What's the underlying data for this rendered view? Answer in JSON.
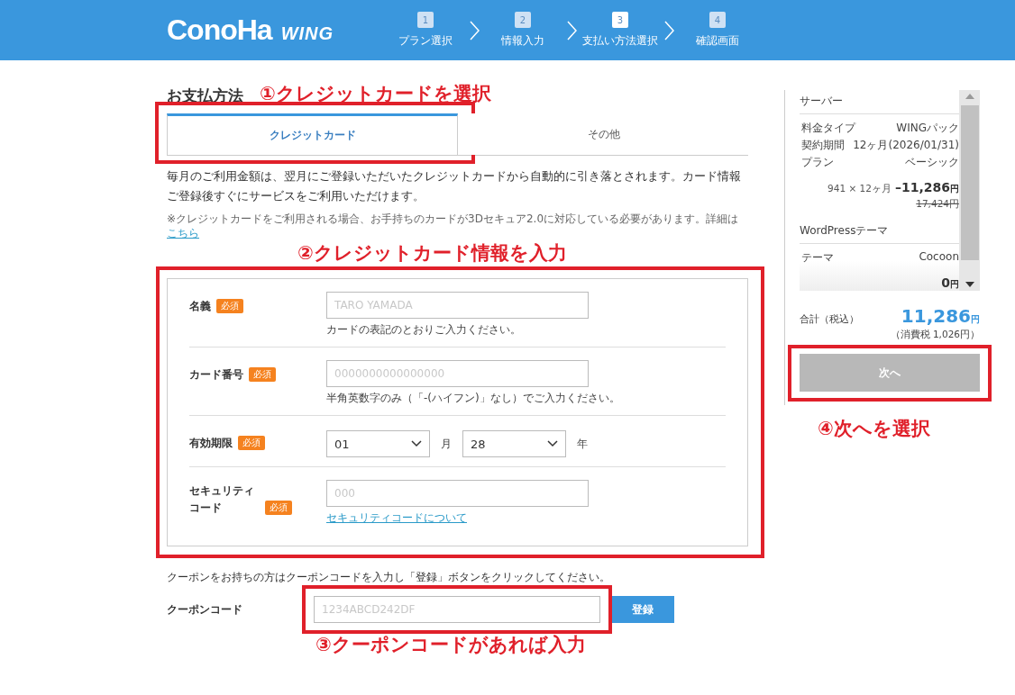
{
  "header": {
    "logo": "ConoHa",
    "product": "WING",
    "steps": [
      {
        "number": "1",
        "label": "プラン選択",
        "selected": false
      },
      {
        "number": "2",
        "label": "情報入力",
        "selected": false
      },
      {
        "number": "3",
        "label": "支払い方法選択",
        "selected": true
      },
      {
        "number": "4",
        "label": "確認画面",
        "selected": false
      }
    ]
  },
  "payment": {
    "title": "お支払方法",
    "tabs": [
      {
        "label": "クレジットカード",
        "selected": true
      },
      {
        "label": "その他",
        "selected": false
      }
    ],
    "description": "毎月のご利用金額は、翌月にご登録いただいたクレジットカードから自動的に引き落とされます。カード情報ご登録後すぐにサービスをご利用いただけます。",
    "note": "※クレジットカードをご利用される場合、お手持ちのカードが3Dセキュア2.0に対応している必要があります。詳細は",
    "note_link": "こちら",
    "fields": [
      {
        "kind": "text",
        "label": "名義",
        "badge": "必須",
        "placeholder": "TARO YAMADA",
        "hint": "カードの表記のとおりご入力ください。"
      },
      {
        "kind": "text",
        "label": "カード番号",
        "badge": "必須",
        "placeholder": "0000000000000000",
        "hint": "半角英数字のみ（「-(ハイフン)」なし）でご入力ください。"
      },
      {
        "kind": "expiry",
        "label": "有効期限",
        "badge": "必須",
        "selects": [
          {
            "value": "01",
            "unit": "月"
          },
          {
            "value": "28",
            "unit": "年"
          }
        ]
      },
      {
        "kind": "cvc",
        "label": "セキュリティコード",
        "badge": "必須",
        "placeholder": "000",
        "help_link": "セキュリティコードについて"
      }
    ]
  },
  "coupon": {
    "text": "クーポンをお持ちの方はクーポンコードを入力し「登録」ボタンをクリックしてください。",
    "label": "クーポンコード",
    "placeholder": "1234ABCD242DF",
    "button": "登録"
  },
  "summary": {
    "sections": [
      {
        "title": "サーバー",
        "rows": [
          {
            "label": "料金タイプ",
            "value": "WINGパック"
          },
          {
            "label": "契約期間",
            "value": "12ヶ月(2026/01/31)"
          },
          {
            "label": "プラン",
            "value": "ベーシック"
          }
        ],
        "formula": "941 × 12ヶ月",
        "price": "–11,286",
        "currency": "円",
        "original_price": "17,424円"
      },
      {
        "title": "WordPressテーマ",
        "rows": [
          {
            "label": "テーマ",
            "value": "Cocoon"
          }
        ],
        "price": "0",
        "currency": "円"
      }
    ],
    "total_label": "合計（税込）",
    "total": "11,286",
    "total_currency": "円",
    "tax": "（消費税 1,026円）",
    "next_button": {
      "label": "次へ",
      "disabled": true
    }
  },
  "annotations": [
    {
      "text": "①クレジットカードを選択"
    },
    {
      "text": "②クレジットカード情報を入力"
    },
    {
      "text": "③クーポンコードがあれば入力"
    },
    {
      "text": "④次へを選択"
    }
  ]
}
